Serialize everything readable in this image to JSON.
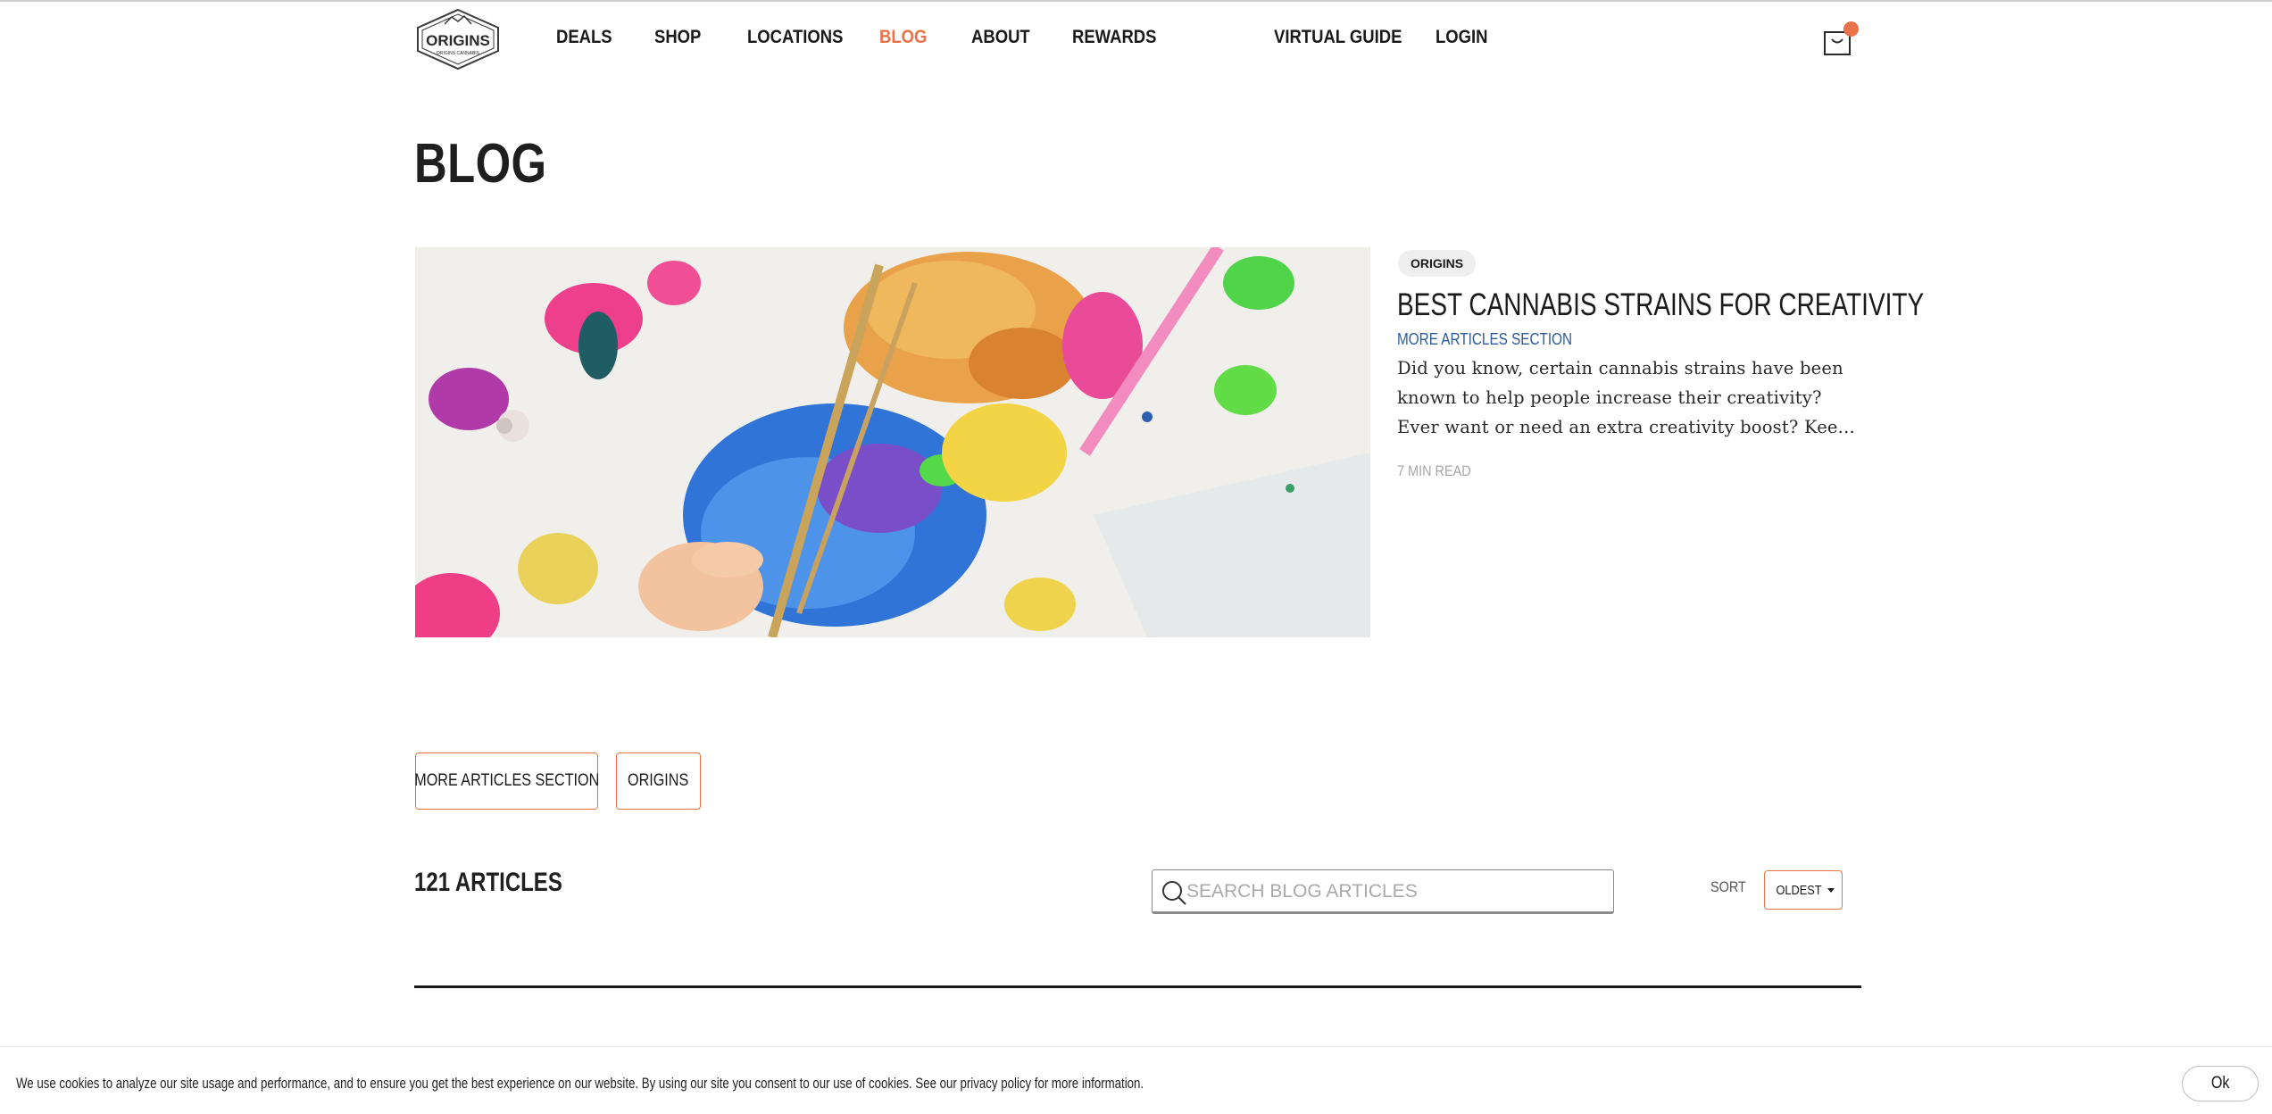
{
  "header": {
    "logo_text": "ORIGINS",
    "logo_subtext": "ORIGINS CANNABIS",
    "nav": [
      {
        "label": "DEALS"
      },
      {
        "label": "SHOP"
      },
      {
        "label": "LOCATIONS"
      },
      {
        "label": "BLOG",
        "active": true
      },
      {
        "label": "ABOUT"
      },
      {
        "label": "REWARDS"
      },
      {
        "label": "VIRTUAL GUIDE"
      },
      {
        "label": "LOGIN"
      }
    ],
    "cart_icon": "shopping-bag-icon"
  },
  "page": {
    "title": "BLOG"
  },
  "featured": {
    "tag": "ORIGINS",
    "title": "BEST CANNABIS STRAINS FOR CREATIVITY",
    "section": "MORE ARTICLES SECTION",
    "excerpt_lines": [
      "Did you know, certain cannabis strains have been",
      "known to help people increase their creativity?",
      "Ever want or need an extra creativity boost? Kee..."
    ],
    "read_time": "7 MIN READ"
  },
  "filters": {
    "chips": [
      "MORE ARTICLES SECTION",
      "ORIGINS"
    ]
  },
  "articles": {
    "count_label": "121 ARTICLES",
    "search_placeholder": "SEARCH BLOG ARTICLES",
    "sort_label": "SORT",
    "sort_value": "OLDEST"
  },
  "cookie": {
    "text": "We use cookies to analyze our site usage and performance, and to ensure you get the best experience on our website. By using our site you consent to our use of cookies. See our privacy policy for more information.",
    "ok_label": "Ok"
  },
  "colors": {
    "accent": "#e8734a",
    "link_blue": "#2d5b9a",
    "text": "#1f1f1f",
    "muted": "#a7a7a7"
  }
}
